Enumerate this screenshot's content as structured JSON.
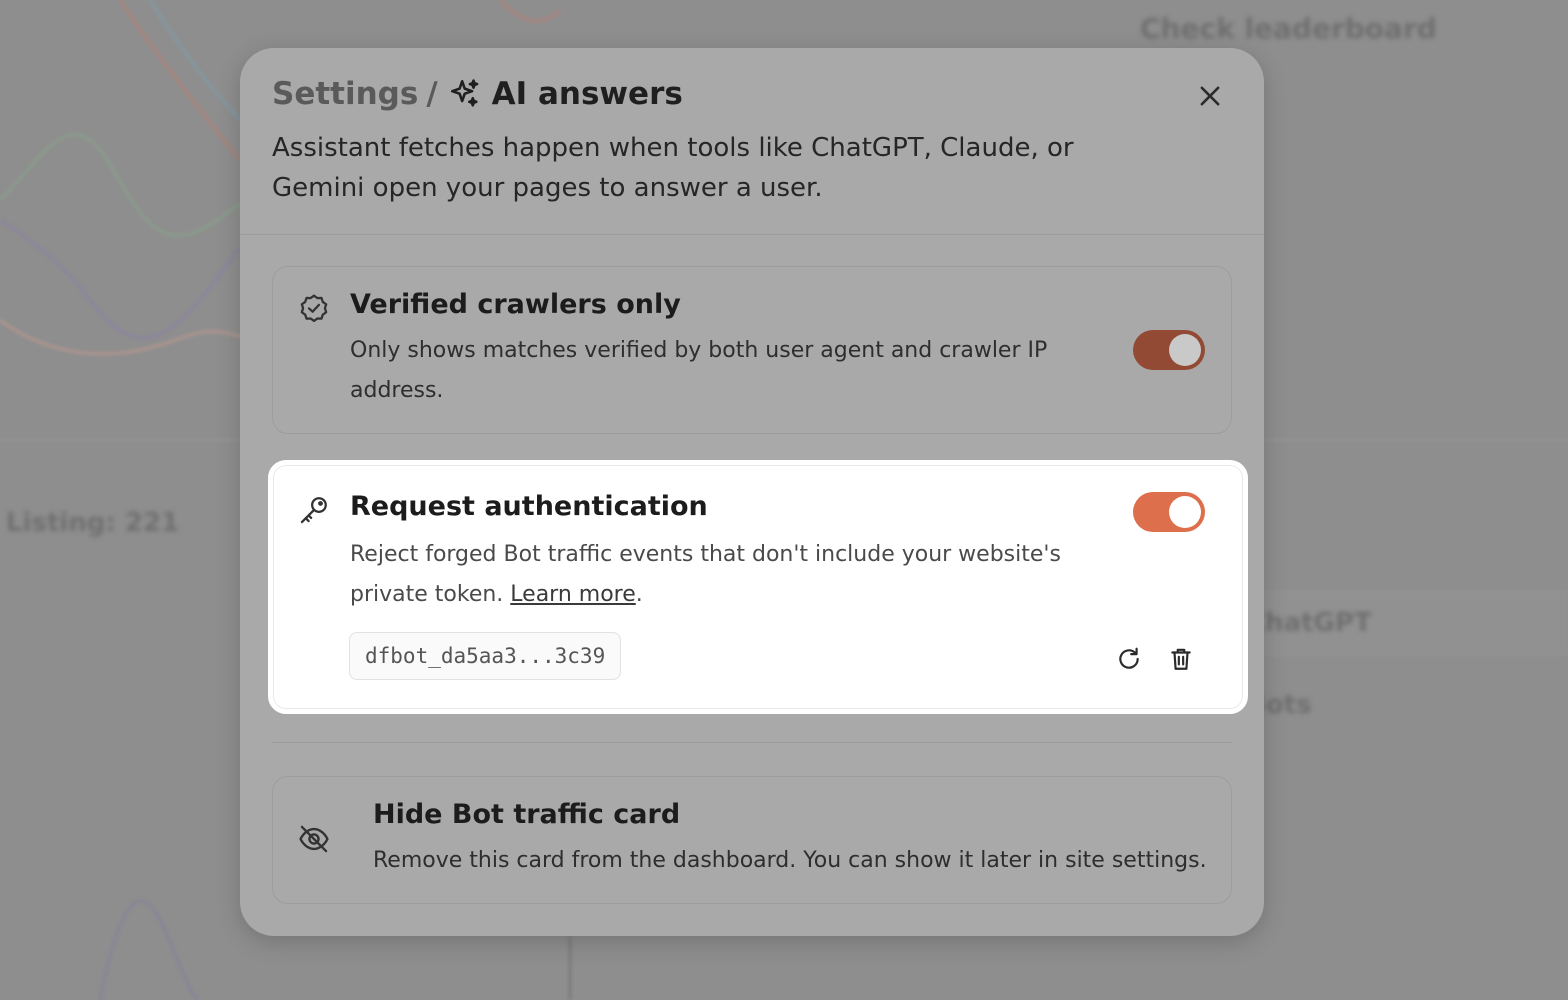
{
  "background": {
    "header_fragment": "Check leaderboard",
    "left_fragment": "Listing: 221",
    "row_fragment_1": "ChatGPT",
    "row_fragment_2": "Bots"
  },
  "modal": {
    "breadcrumb_parent": "Settings",
    "breadcrumb_separator": "/",
    "title": "AI answers",
    "title_icon": "sparkles-icon",
    "close_icon": "close-icon",
    "description": "Assistant fetches happen when tools like ChatGPT, Claude, or Gemini open your pages to answer a user."
  },
  "verified": {
    "icon": "badge-check-icon",
    "title": "Verified crawlers only",
    "description": "Only shows matches verified by both user agent and crawler IP address.",
    "enabled": true,
    "toggle_color": "#934a35"
  },
  "auth": {
    "icon": "key-icon",
    "title": "Request authentication",
    "description": "Reject forged Bot traffic events that don't include your website's private token.",
    "link_text": "Learn more",
    "link_suffix": ".",
    "enabled": true,
    "toggle_color": "#dd6f4c",
    "token": "dfbot_da5aa3...3c39",
    "regenerate_icon": "refresh-icon",
    "delete_icon": "trash-icon"
  },
  "hide": {
    "icon": "eye-off-icon",
    "title": "Hide Bot traffic card",
    "description": "Remove this card from the dashboard. You can show it later in site settings."
  },
  "colors": {
    "overlay": "#8e8e8e",
    "modal": "#a9a9a9",
    "highlight_card": "#ffffff",
    "accent": "#dd6f4c"
  }
}
